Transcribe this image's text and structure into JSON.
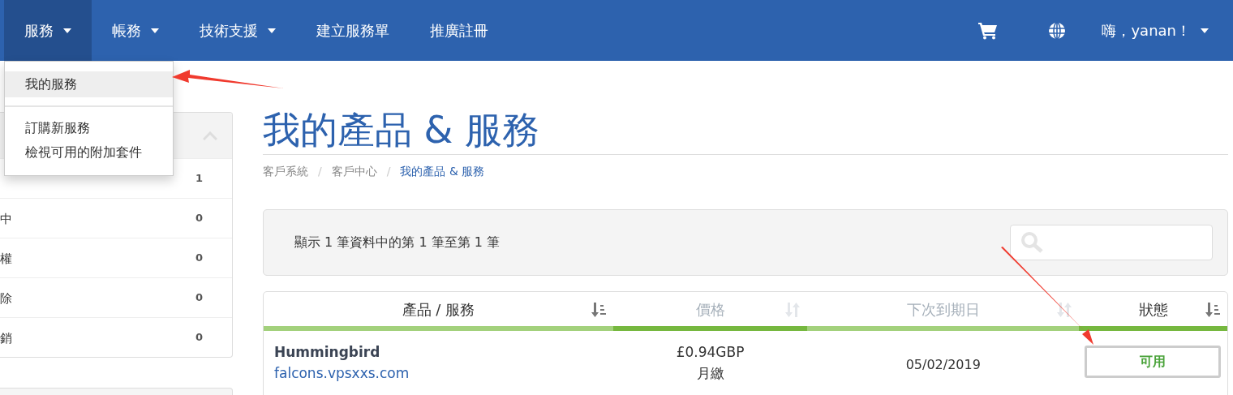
{
  "navbar": {
    "items": [
      {
        "label": "服務",
        "dropdown": true,
        "selected": true
      },
      {
        "label": "帳務",
        "dropdown": true,
        "selected": false
      },
      {
        "label": "技術支援",
        "dropdown": true,
        "selected": false
      },
      {
        "label": "建立服務單",
        "dropdown": false,
        "selected": false
      },
      {
        "label": "推廣註冊",
        "dropdown": false,
        "selected": false
      }
    ],
    "user": "嗨，yanan！"
  },
  "dropdown_menu": {
    "items": [
      {
        "label": "我的服務",
        "selected": true
      },
      {
        "label": "訂購新服務",
        "selected": false
      },
      {
        "label": "檢視可用的附加套件",
        "selected": false
      }
    ]
  },
  "sidebar": {
    "rows": [
      {
        "count": "1"
      },
      {
        "label": "中",
        "count": "0"
      },
      {
        "label": "權",
        "count": "0"
      },
      {
        "label": "除",
        "count": "0"
      },
      {
        "label": "銷",
        "count": "0"
      }
    ]
  },
  "page_title": "我的產品 & 服務",
  "breadcrumb": [
    {
      "label": "客戶系統",
      "current": false
    },
    {
      "separator": "/"
    },
    {
      "label": "客戶中心",
      "current": false
    },
    {
      "separator": "/"
    },
    {
      "label": "我的產品 & 服務",
      "current": true
    }
  ],
  "info_text": "顯示 1 筆資料中的第 1 筆至第 1 筆",
  "table": {
    "columns": [
      {
        "label": "產品 / 服務",
        "active": true,
        "underline_dark": false
      },
      {
        "label": "價格",
        "active": false,
        "underline_dark": true
      },
      {
        "label": "下次到期日",
        "active": false,
        "underline_dark": false
      },
      {
        "label": "狀態",
        "active": true,
        "underline_dark": true
      }
    ],
    "rows": [
      {
        "product": "Hummingbird",
        "domain": "falcons.vpsxxs.com",
        "price": "£0.94GBP",
        "cycle": "月繳",
        "due": "05/02/2019",
        "status": "可用"
      }
    ]
  }
}
